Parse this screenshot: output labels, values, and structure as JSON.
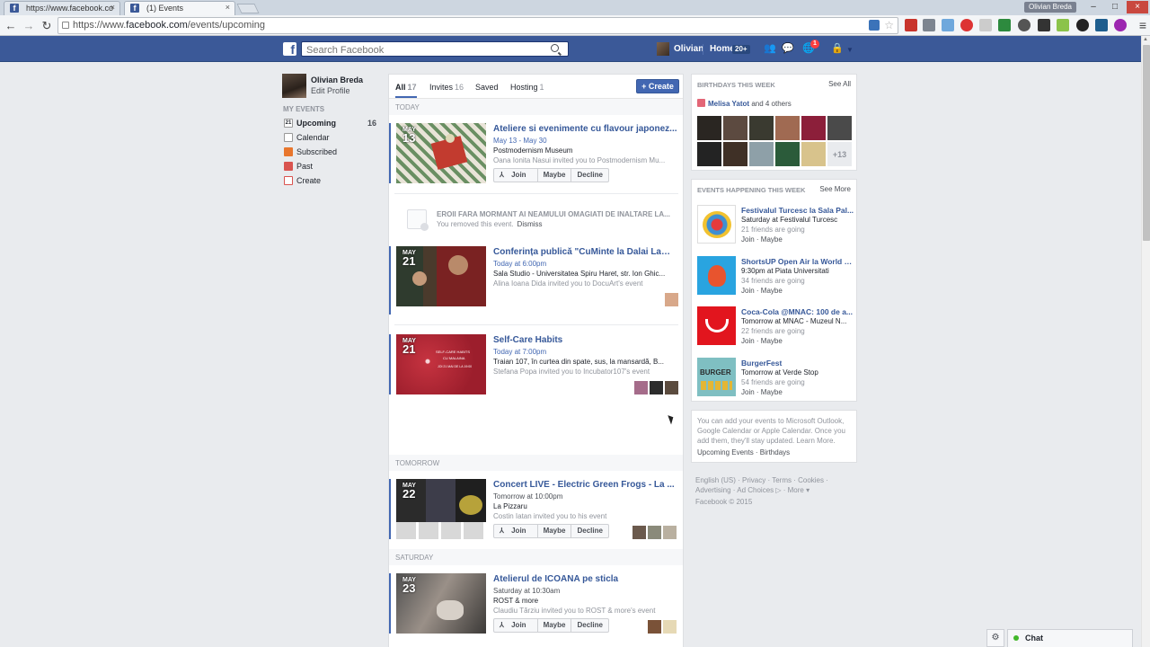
{
  "browser": {
    "tabs": [
      {
        "title": "https://www.facebook.co"
      },
      {
        "title": "(1) Events"
      }
    ],
    "url_scheme": "https://www.",
    "url_host": "facebook.com",
    "url_path": "/events/upcoming",
    "profile_label": "Olivian Breda",
    "close_glyph": "×"
  },
  "topbar": {
    "logo": "f",
    "search_placeholder": "Search Facebook",
    "user_name": "Olivian",
    "home_label": "Home",
    "home_count": "20+",
    "notif_count": "1"
  },
  "left_nav": {
    "name": "Olivian Breda",
    "edit_profile": "Edit Profile",
    "section_header": "MY EVENTS",
    "items": [
      {
        "label": "Upcoming",
        "count": "16"
      },
      {
        "label": "Calendar"
      },
      {
        "label": "Subscribed"
      },
      {
        "label": "Past"
      },
      {
        "label": "Create"
      }
    ]
  },
  "tabs": {
    "all_label": "All",
    "all_count": "17",
    "invites_label": "Invites",
    "invites_count": "16",
    "saved_label": "Saved",
    "hosting_label": "Hosting",
    "hosting_count": "1",
    "create_label": "+ Create"
  },
  "sections": {
    "today": "TODAY",
    "tomorrow": "TOMORROW",
    "saturday": "SATURDAY"
  },
  "actions": {
    "join": "Join",
    "maybe": "Maybe",
    "decline": "Decline"
  },
  "events": [
    {
      "month": "MAY",
      "day": "13",
      "title": "Ateliere si evenimente cu flavour japonez...",
      "time": "May 13 - May 30",
      "place": "Postmodernism Museum",
      "invited": "Oana Ionita Nasui invited you to Postmodernism Mu..."
    },
    {
      "month": "MAY",
      "day": "21",
      "title": "Conferința publică \"CuMinte la Dalai Lama\"",
      "time": "Today at 6:00pm",
      "place": "Sala Studio - Universitatea Spiru Haret, str. Ion Ghic...",
      "invited": "Alina Ioana Dida invited you to DocuArt's event"
    },
    {
      "month": "MAY",
      "day": "21",
      "title": "Self-Care Habits",
      "time": "Today at 7:00pm",
      "place": "Traian 107, în curtea din spate, sus, la mansardă, B...",
      "invited": "Stefana Popa invited you to Incubator107's event"
    },
    {
      "month": "MAY",
      "day": "22",
      "title": "Concert LIVE - Electric Green Frogs - La ...",
      "time": "Tomorrow at 10:00pm",
      "place": "La Pizzaru",
      "invited": "Costin Iatan invited you to his event"
    },
    {
      "month": "MAY",
      "day": "23",
      "title": "Atelierul de ICOANA pe sticla",
      "time": "Saturday at 10:30am",
      "place": "ROST & more",
      "invited": "Claudiu Tărziu invited you to ROST & more's event"
    }
  ],
  "removed_event": {
    "title": "EROII FARA MORMANT AI NEAMULUI OMAGIATI DE INALTARE LA...",
    "status": "You removed this event.",
    "dismiss": "Dismiss"
  },
  "self_care_poster": {
    "line1": "SELF-CARE HABITS",
    "line2": "CU MALAINA",
    "line3": "JOI 21 MAI DE LA 19:00"
  },
  "birthdays": {
    "header": "BIRTHDAYS THIS WEEK",
    "see_all": "See All",
    "name": "Melisa Yatot",
    "and_others": " and 4 others",
    "more": "+13"
  },
  "happening": {
    "header": "EVENTS HAPPENING THIS WEEK",
    "see_more": "See More",
    "actions": "Join · Maybe",
    "items": [
      {
        "title": "Festivalul Turcesc la Sala Pal...",
        "when": "Saturday at Festivalul Turcesc",
        "friends": "21 friends are going"
      },
      {
        "title": "ShortsUP Open Air la World P...",
        "when": "9:30pm at Piata Universitati",
        "friends": "34 friends are going"
      },
      {
        "title": "Coca-Cola @MNAC: 100 de a...",
        "when": "Tomorrow at MNAC - Muzeul N...",
        "friends": "22 friends are going"
      },
      {
        "title": "BurgerFest",
        "when": "Tomorrow at Verde Stop",
        "friends": "54 friends are going",
        "logo_text": "BURGER"
      }
    ]
  },
  "export": {
    "text": "You can add your events to Microsoft Outlook, Google Calendar or Apple Calendar. Once you add them, they'll stay updated. Learn More.",
    "links": "Upcoming Events · Birthdays"
  },
  "footer": {
    "links": "English (US) · Privacy · Terms · Cookies · Advertising · Ad Choices ▷ · More ▾",
    "copyright": "Facebook © 2015"
  },
  "chat": {
    "label": "Chat"
  }
}
